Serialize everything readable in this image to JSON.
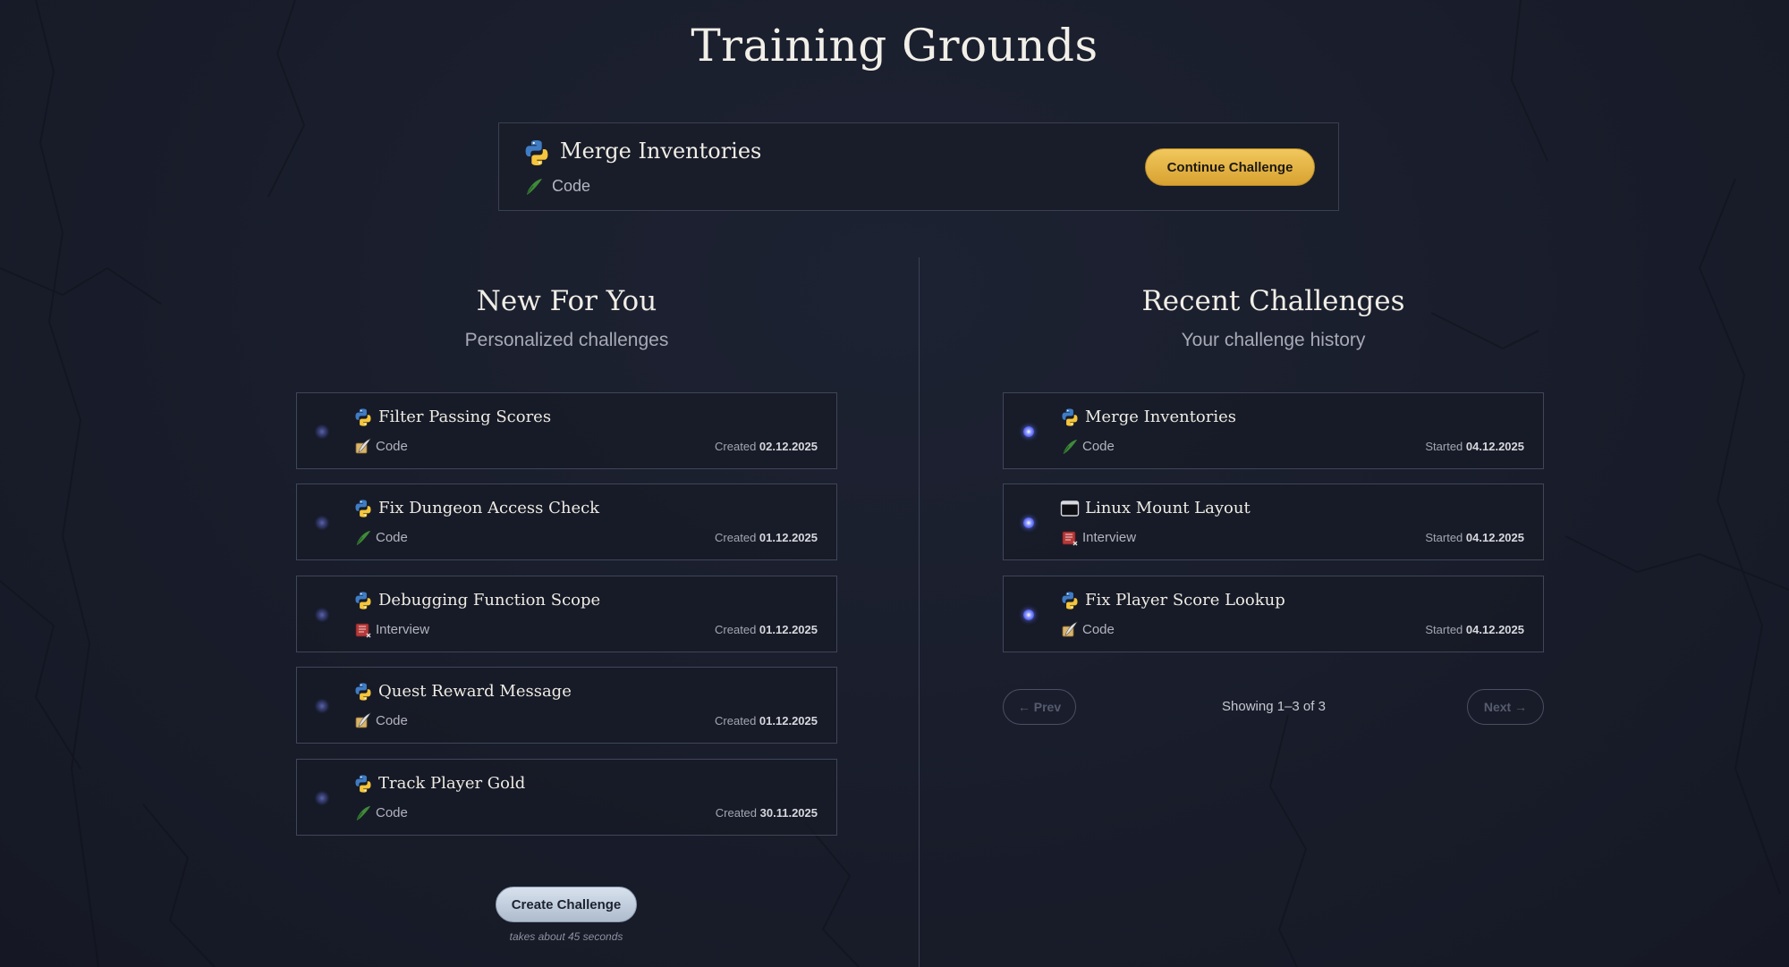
{
  "page": {
    "title": "Training Grounds"
  },
  "featured": {
    "title": "Merge Inventories",
    "language_icon": "python-icon",
    "category": "Code",
    "category_icon": "quill-icon",
    "action_label": "Continue Challenge"
  },
  "new_for_you": {
    "title": "New For You",
    "subtitle": "Personalized challenges",
    "items": [
      {
        "title": "Filter Passing Scores",
        "language_icon": "python-icon",
        "category": "Code",
        "category_icon": "scroll-quill-icon",
        "date_label": "Created",
        "date": "02.12.2025"
      },
      {
        "title": "Fix Dungeon Access Check",
        "language_icon": "python-icon",
        "category": "Code",
        "category_icon": "quill-icon",
        "date_label": "Created",
        "date": "01.12.2025"
      },
      {
        "title": "Debugging Function Scope",
        "language_icon": "python-icon",
        "category": "Interview",
        "category_icon": "book-icon",
        "date_label": "Created",
        "date": "01.12.2025"
      },
      {
        "title": "Quest Reward Message",
        "language_icon": "python-icon",
        "category": "Code",
        "category_icon": "scroll-quill-icon",
        "date_label": "Created",
        "date": "01.12.2025"
      },
      {
        "title": "Track Player Gold",
        "language_icon": "python-icon",
        "category": "Code",
        "category_icon": "quill-icon",
        "date_label": "Created",
        "date": "30.11.2025"
      }
    ],
    "create_label": "Create Challenge",
    "create_note": "takes about 45 seconds"
  },
  "recent": {
    "title": "Recent Challenges",
    "subtitle": "Your challenge history",
    "items": [
      {
        "title": "Merge Inventories",
        "language_icon": "python-icon",
        "category": "Code",
        "category_icon": "quill-icon",
        "date_label": "Started",
        "date": "04.12.2025"
      },
      {
        "title": "Linux Mount Layout",
        "language_icon": "terminal-icon",
        "category": "Interview",
        "category_icon": "book-icon",
        "date_label": "Started",
        "date": "04.12.2025"
      },
      {
        "title": "Fix Player Score Lookup",
        "language_icon": "python-icon",
        "category": "Code",
        "category_icon": "scroll-quill-icon",
        "date_label": "Started",
        "date": "04.12.2025"
      }
    ],
    "pagination": {
      "prev_label": "← Prev",
      "next_label": "Next →",
      "status": "Showing 1–3 of 3"
    }
  },
  "colors": {
    "background": "#191d2b",
    "accent_gold": "#e4b344",
    "card_border": "#40455a",
    "dot_active": "#5f6cff"
  }
}
